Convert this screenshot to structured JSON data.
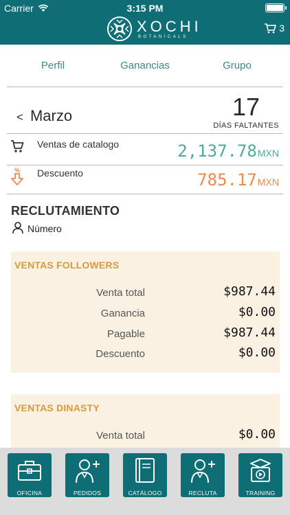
{
  "status_bar": {
    "carrier": "Carrier",
    "time": "3:15 PM",
    "battery_level": 1.0
  },
  "header": {
    "brand": "XOCHI",
    "brand_sub": "BOTANICALS",
    "cart_count": "3"
  },
  "tabs": [
    {
      "label": "Perfil"
    },
    {
      "label": "Ganancias"
    },
    {
      "label": "Grupo"
    }
  ],
  "period": {
    "chevron": "<",
    "month": "Marzo",
    "days_remaining": "17",
    "days_label": "DÍAS FALTANTES"
  },
  "summary": [
    {
      "icon": "cart-icon",
      "label": "Ventas de catalogo",
      "value": "2,137.78",
      "currency": "MXN",
      "color": "#4daa9a"
    },
    {
      "icon": "discount-icon",
      "label": "Descuento",
      "value": "785.17",
      "currency": "MXN",
      "color": "#ea8a4e"
    }
  ],
  "recruiting": {
    "title": "RECLUTAMIENTO",
    "number_label": "Número"
  },
  "followers": {
    "title": "VENTAS FOLLOWERS",
    "rows": [
      {
        "label": "Venta total",
        "value": "$987.44"
      },
      {
        "label": "Ganancia",
        "value": "$0.00"
      },
      {
        "label": "Pagable",
        "value": "$987.44"
      },
      {
        "label": "Descuento",
        "value": "$0.00"
      }
    ]
  },
  "dinasty": {
    "title": "VENTAS DINASTY",
    "rows": [
      {
        "label": "Venta total",
        "value": "$0.00"
      }
    ]
  },
  "nav": [
    {
      "label": "OFICINA",
      "icon": "briefcase-icon"
    },
    {
      "label": "PEDIDOS",
      "icon": "person-add-icon"
    },
    {
      "label": "CATÁLOGO",
      "icon": "book-icon"
    },
    {
      "label": "RECLUTA",
      "icon": "person-add-icon"
    },
    {
      "label": "TRAINING",
      "icon": "training-icon"
    }
  ],
  "colors": {
    "brand": "#0f6e75",
    "accent_green": "#4daa9a",
    "accent_orange": "#ea8a4e",
    "card_bg": "#fbf1e3",
    "card_title": "#d79a3d",
    "bottom_bar": "#dcdcdc"
  }
}
